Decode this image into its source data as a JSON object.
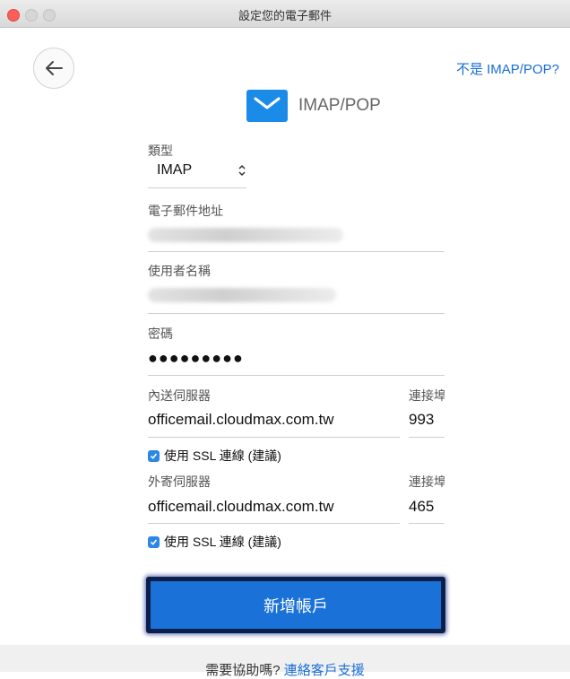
{
  "window": {
    "title": "設定您的電子郵件"
  },
  "top_link": "不是 IMAP/POP?",
  "header": {
    "title": "IMAP/POP"
  },
  "form": {
    "type": {
      "label": "類型",
      "value": "IMAP"
    },
    "email": {
      "label": "電子郵件地址"
    },
    "username": {
      "label": "使用者名稱"
    },
    "password": {
      "label": "密碼",
      "masked": "●●●●●●●●●"
    },
    "incoming": {
      "label": "內送伺服器",
      "value": "officemail.cloudmax.com.tw",
      "port_label": "連接埠",
      "port": "993",
      "ssl_label": "使用 SSL 連線 (建議)",
      "ssl_checked": true
    },
    "outgoing": {
      "label": "外寄伺服器",
      "value": "officemail.cloudmax.com.tw",
      "port_label": "連接埠",
      "port": "465",
      "ssl_label": "使用 SSL 連線 (建議)",
      "ssl_checked": true
    }
  },
  "submit_label": "新增帳戶",
  "footer": {
    "question": "需要協助嗎?",
    "link": "連絡客戶支援"
  },
  "colors": {
    "accent": "#1a72d8",
    "logo": "#1b8be8",
    "link": "#1a6ed8"
  },
  "icons": {
    "back": "arrow-left-icon",
    "logo": "mail-envelope-icon",
    "select": "chevron-updown-icon",
    "check": "checkmark-icon"
  }
}
